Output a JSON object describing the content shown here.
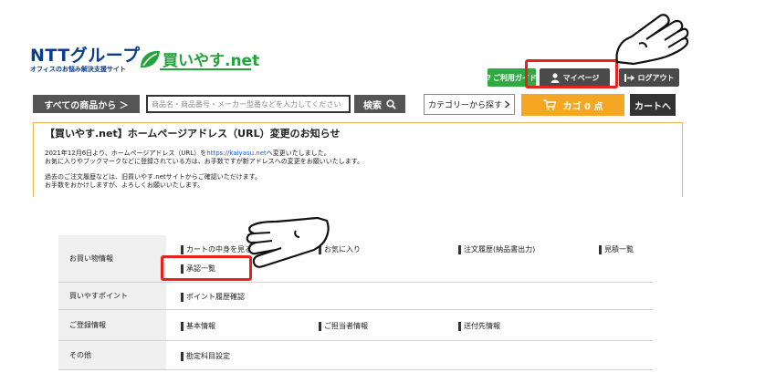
{
  "logo": {
    "ntt": "NTTグループ",
    "tagline": "オフィスのお悩み解決支援サイト",
    "kaiyasu": "買いやす.net"
  },
  "top_buttons": {
    "guide": "ご利用ガイド",
    "mypage": "マイページ",
    "logout": "ログアウト"
  },
  "search": {
    "all_products": "すべての商品から ＞",
    "placeholder": "商品名・商品番号・メーカー型番などを入力してください",
    "search_button": "検索",
    "category_button": "カテゴリーから探す",
    "cart_button": "カゴ 0 点",
    "cart_go_button": "カートへ"
  },
  "notice": {
    "title": "【買いやす.net】ホームページアドレス（URL）変更のお知らせ",
    "line1_a": "2021年12月6日より、ホームページアドレス（URL）を",
    "line1_link": "https://kaiyasu.net",
    "line1_b": "へ変更いたしました。",
    "line2": "お気に入りやブックマークなどに登録されている方は、お手数ですが新アドレスへの変更をお願いいたします。",
    "line3": "過去のご注文履歴などは、旧買いやす.netサイトからご確認いただけます。",
    "line4": "お手数をおかけしますが、よろしくお願いいたします。"
  },
  "menu": {
    "shopping": {
      "category": "お買い物情報",
      "cart_contents": "カートの中身を見る",
      "favorites": "お気に入り",
      "order_history": "注文履歴(納品書出力)",
      "quotes": "見積一覧",
      "approval": "承認一覧"
    },
    "points": {
      "category": "買いやすポイント",
      "point_history": "ポイント履歴確認"
    },
    "registration": {
      "category": "ご登録情報",
      "basic": "基本情報",
      "contact": "ご担当者情報",
      "shipping": "送付先情報"
    },
    "other": {
      "category": "その他",
      "accounts": "勘定科目設定"
    }
  },
  "colors": {
    "highlight": "#e8211e",
    "brand_blue": "#0a3d8f",
    "brand_green": "#24a33c",
    "cart_orange": "#f5a623",
    "notice_border": "#f2b54a"
  },
  "icons": {
    "mypage": "user-icon",
    "logout": "logout-arrow-icon",
    "search": "magnifier-icon",
    "cart": "cart-icon",
    "pointer": "pointing-hand-icon"
  }
}
